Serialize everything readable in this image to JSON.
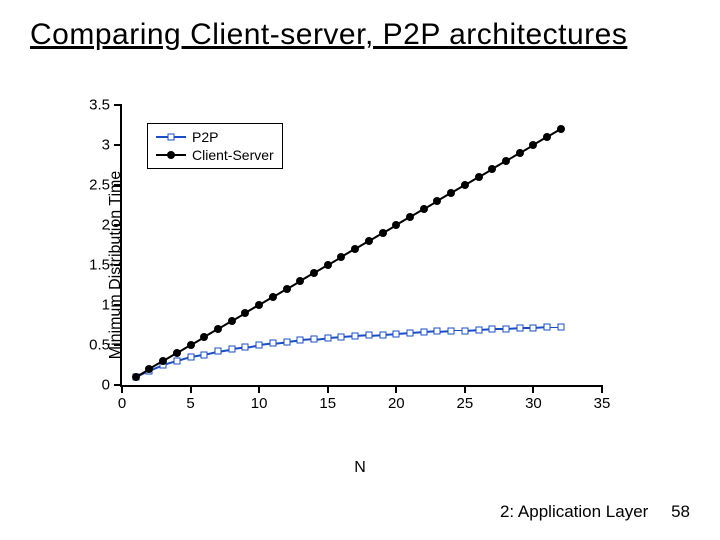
{
  "title": "Comparing Client-server, P2P architectures",
  "footer": {
    "section": "2: Application Layer",
    "page": "58"
  },
  "chart_data": {
    "type": "line",
    "xlabel": "N",
    "ylabel": "Minimum Distribution Time",
    "xlim": [
      0,
      35
    ],
    "ylim": [
      0,
      3.5
    ],
    "xticks": [
      0,
      5,
      10,
      15,
      20,
      25,
      30,
      35
    ],
    "yticks": [
      0,
      0.5,
      1,
      1.5,
      2,
      2.5,
      3,
      3.5
    ],
    "legend_position": "upper-left",
    "series": [
      {
        "name": "P2P",
        "marker": "square-open",
        "color": "#1a4ec8",
        "x": [
          1,
          2,
          3,
          4,
          5,
          6,
          7,
          8,
          9,
          10,
          11,
          12,
          13,
          14,
          15,
          16,
          17,
          18,
          19,
          20,
          21,
          22,
          23,
          24,
          25,
          26,
          27,
          28,
          29,
          30,
          31,
          32
        ],
        "y": [
          0.1,
          0.18,
          0.25,
          0.3,
          0.35,
          0.38,
          0.42,
          0.45,
          0.47,
          0.5,
          0.52,
          0.54,
          0.56,
          0.57,
          0.59,
          0.6,
          0.61,
          0.62,
          0.63,
          0.64,
          0.65,
          0.66,
          0.67,
          0.68,
          0.68,
          0.69,
          0.7,
          0.7,
          0.71,
          0.71,
          0.72,
          0.72
        ]
      },
      {
        "name": "Client-Server",
        "marker": "circle-filled",
        "color": "#000000",
        "x": [
          1,
          2,
          3,
          4,
          5,
          6,
          7,
          8,
          9,
          10,
          11,
          12,
          13,
          14,
          15,
          16,
          17,
          18,
          19,
          20,
          21,
          22,
          23,
          24,
          25,
          26,
          27,
          28,
          29,
          30,
          31,
          32
        ],
        "y": [
          0.1,
          0.2,
          0.3,
          0.4,
          0.5,
          0.6,
          0.7,
          0.8,
          0.9,
          1.0,
          1.1,
          1.2,
          1.3,
          1.4,
          1.5,
          1.6,
          1.7,
          1.8,
          1.9,
          2.0,
          2.1,
          2.2,
          2.3,
          2.4,
          2.5,
          2.6,
          2.7,
          2.8,
          2.9,
          3.0,
          3.1,
          3.2
        ]
      }
    ]
  }
}
